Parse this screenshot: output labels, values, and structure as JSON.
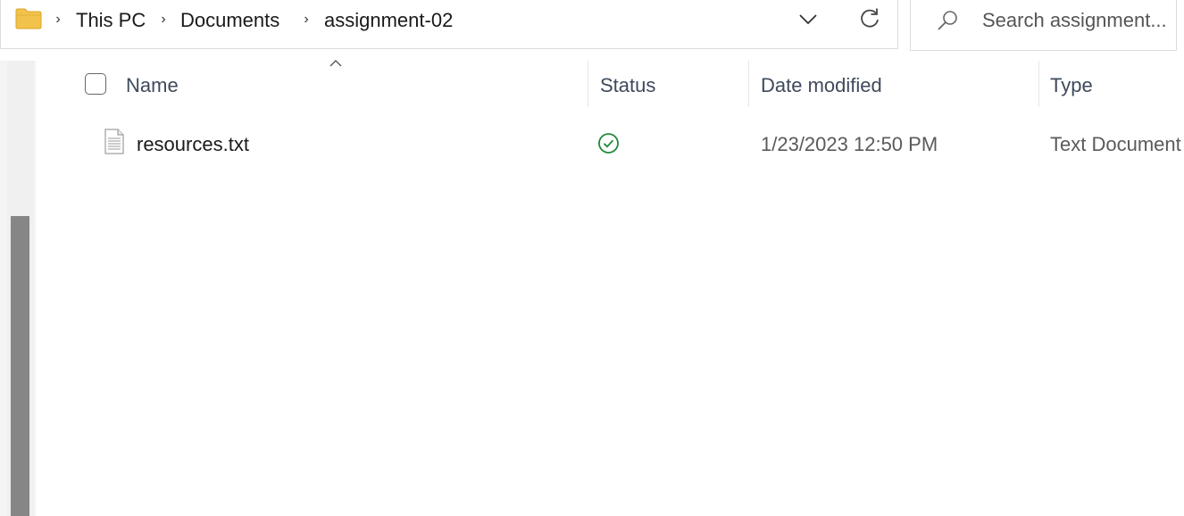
{
  "address_bar": {
    "breadcrumb": [
      "This PC",
      "Documents",
      "assignment-02"
    ]
  },
  "search": {
    "placeholder": "Search assignment..."
  },
  "columns": {
    "name": "Name",
    "status": "Status",
    "date_modified": "Date modified",
    "type": "Type"
  },
  "files": [
    {
      "name": "resources.txt",
      "status_icon": "synced-check-icon",
      "date_modified": "1/23/2023 12:50 PM",
      "type": "Text Document"
    }
  ],
  "colors": {
    "status_ok": "#1f8a3a",
    "folder": "#f2c34a",
    "scroll_thumb": "#868686"
  },
  "icons": [
    "folder-icon",
    "chevron-right-icon",
    "chevron-down-icon",
    "refresh-icon",
    "search-icon",
    "sort-up-icon",
    "text-file-icon",
    "synced-check-icon"
  ]
}
